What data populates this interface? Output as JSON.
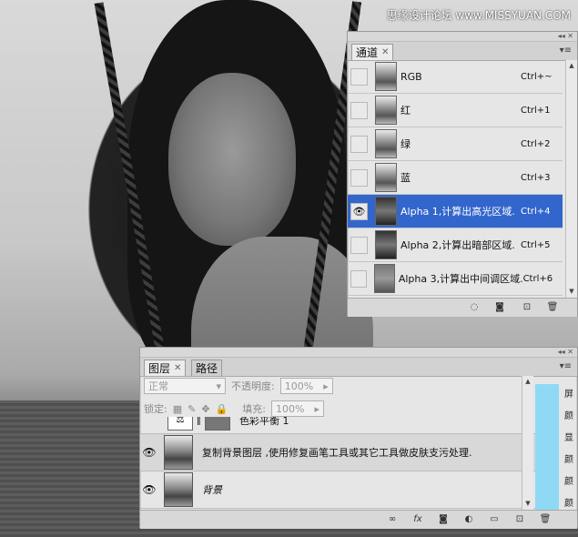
{
  "watermark": "思缘设计论坛 www.MISSYUAN.COM",
  "channels": {
    "tab": "通道",
    "rows": [
      {
        "name": "RGB",
        "shortcut": "Ctrl+~"
      },
      {
        "name": "红",
        "shortcut": "Ctrl+1"
      },
      {
        "name": "绿",
        "shortcut": "Ctrl+2"
      },
      {
        "name": "蓝",
        "shortcut": "Ctrl+3"
      },
      {
        "name": "Alpha 1,计算出高光区域.",
        "shortcut": "Ctrl+4",
        "selected": true
      },
      {
        "name": "Alpha 2,计算出暗部区域.",
        "shortcut": "Ctrl+5"
      },
      {
        "name": "Alpha 3,计算出中间调区域.",
        "shortcut": "Ctrl+6"
      }
    ]
  },
  "layers": {
    "tabs": [
      "图层",
      "路径"
    ],
    "blend_mode": "正常",
    "opacity_label": "不透明度:",
    "opacity_value": "100%",
    "lock_label": "锁定:",
    "fill_label": "填充:",
    "fill_value": "100%",
    "rows": [
      {
        "name": "色彩平衡 1"
      },
      {
        "name": "复制背景图层 ,使用修复画笔工具或其它工具做皮肤支污处理."
      },
      {
        "name": "背景"
      }
    ],
    "side_labels": [
      "屏",
      "颜",
      "显",
      "颜",
      "颜",
      "颜"
    ]
  },
  "icons": {
    "eye": "eye-icon",
    "lock": "lock-icon"
  },
  "colors": {
    "selection": "#3366cc",
    "cyan_strip": "#8fd9f5"
  }
}
